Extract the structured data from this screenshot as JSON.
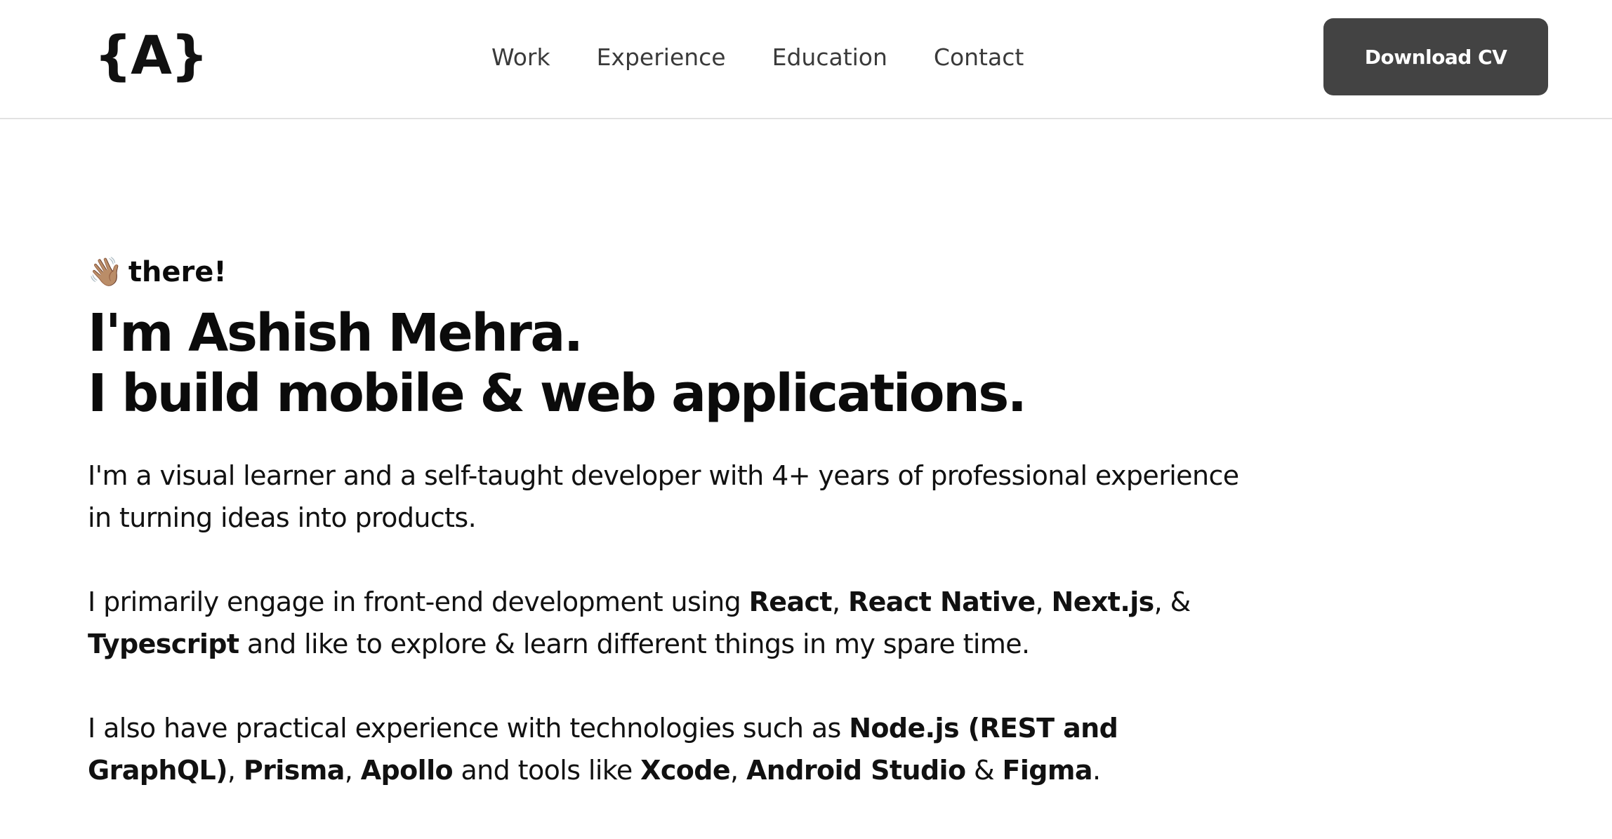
{
  "header": {
    "logo": "{A}",
    "nav": [
      "Work",
      "Experience",
      "Education",
      "Contact"
    ],
    "cta_label": "Download CV"
  },
  "hero": {
    "wave_emoji": "👋🏽",
    "greeting": "there!",
    "headline_line1": "I'm Ashish Mehra.",
    "headline_line2": "I build mobile & web applications.",
    "para1": "I'm a visual learner and a self-taught developer with 4+ years of professional experience in turning ideas into products.",
    "para2": {
      "t1": "I primarily engage in front-end development using ",
      "b1": "React",
      "s1": ", ",
      "b2": "React Native",
      "s2": ", ",
      "b3": "Next.js",
      "s3": ", & ",
      "b4": "Typescript",
      "t2": " and like to explore & learn different things in my spare time."
    },
    "para3": {
      "t1": "I also have practical experience with technologies such as ",
      "b1": "Node.js (REST and GraphQL)",
      "s1": ", ",
      "b2": "Prisma",
      "s2": ", ",
      "b3": "Apollo",
      "t2": " and tools like ",
      "b4": "Xcode",
      "s3": ", ",
      "b5": "Android Studio",
      "s4": " & ",
      "b6": "Figma",
      "s5": "."
    }
  },
  "colors": {
    "cta_background": "#434343",
    "text": "#0b0b0b",
    "nav_text": "#3a3a3a",
    "divider": "#e2e2e2"
  }
}
